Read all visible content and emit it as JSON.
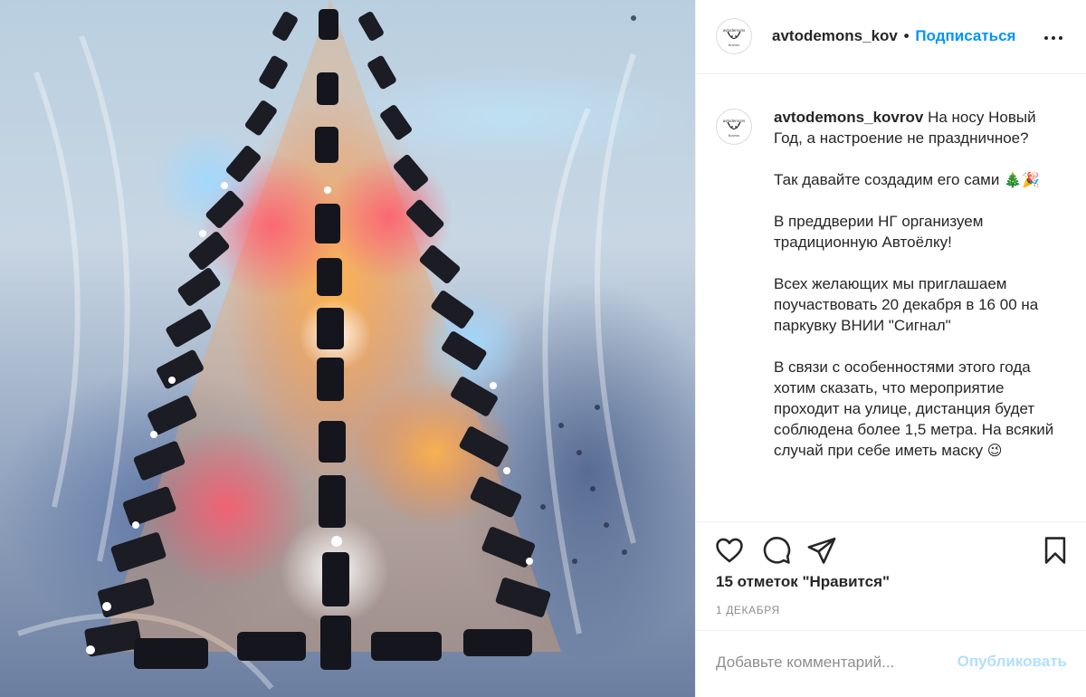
{
  "post": {
    "image_alt": "",
    "header": {
      "username": "avtodemons_kov",
      "separator": "•",
      "follow_label": "Подписаться",
      "more_icon": "more-horizontal-icon"
    },
    "caption": {
      "username": "avtodemons_kovrov",
      "line1": "На носу Новый Год, а настроение не праздничное?",
      "para2": "Так давайте создадим его сами",
      "para2_emoji": "🎄🎉",
      "para3": "В преддверии НГ организуем традиционную Автоёлку!",
      "para4": "Всех желающих мы приглашаем поучаствовать 20 декабря в 16 00 на паркувку ВНИИ \"Сигнал\"",
      "para5": "В связи с особенностями этого года хотим сказать, что мероприятие проходит на улице, дистанция будет соблюдена более 1,5 метра. На всякий случай при себе иметь маску",
      "para5_emoji": "😉"
    },
    "actions": {
      "like_icon": "heart-icon",
      "comment_icon": "comment-icon",
      "share_icon": "paper-plane-icon",
      "save_icon": "bookmark-icon"
    },
    "likes_text": "15 отметок \"Нравится\"",
    "date_text": "1 ДЕКАБРЯ",
    "comment": {
      "placeholder": "Добавьте комментарий...",
      "publish_label": "Опубликовать"
    }
  },
  "colors": {
    "accent": "#0095f6",
    "publish_disabled": "#b2dffc",
    "text": "#262626",
    "muted": "#8e8e8e"
  }
}
